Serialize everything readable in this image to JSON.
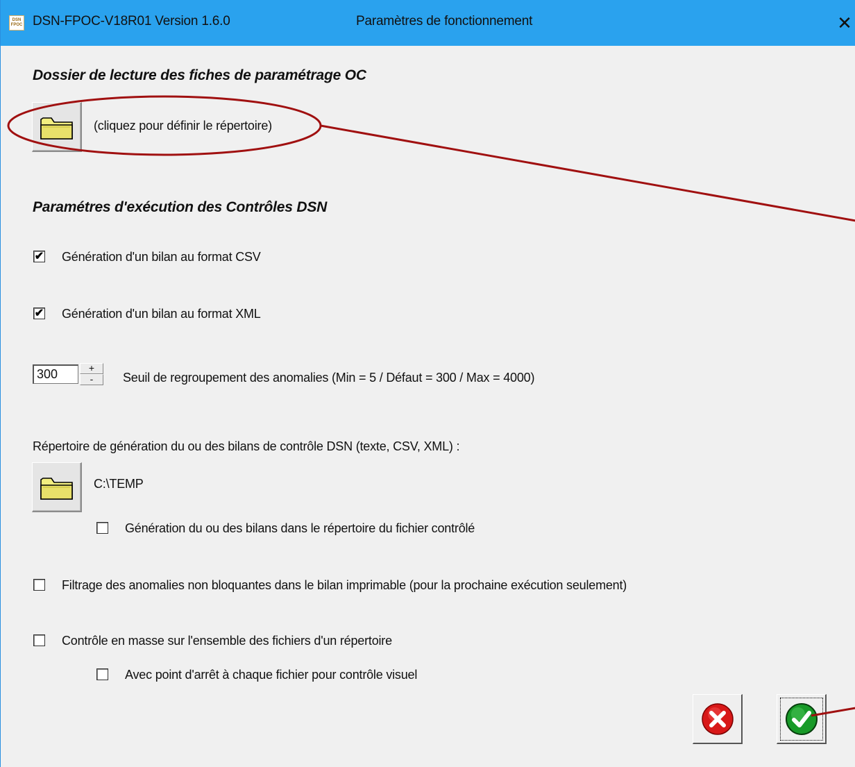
{
  "titlebar": {
    "app_title": "DSN-FPOC-V18R01 Version 1.6.0",
    "window_title": "Paramètres de fonctionnement",
    "close_label": "✕",
    "icon_text": "DSN FPOC"
  },
  "section_oc": {
    "title": "Dossier de lecture des fiches de paramétrage OC",
    "folder_hint": "(cliquez pour définir le répertoire)"
  },
  "section_exec": {
    "title": "Paramétres d'exécution des Contrôles DSN",
    "csv": {
      "label": "Génération d'un bilan au format CSV",
      "checked": true
    },
    "xml": {
      "label": "Génération d'un bilan au format XML",
      "checked": true
    },
    "threshold": {
      "value": "300",
      "label": "Seuil de regroupement des anomalies (Min = 5 / Défaut = 300 / Max = 4000)",
      "up_glyph": "+",
      "down_glyph": "-"
    },
    "output_dir_label": "Répertoire de génération du ou des bilans de contrôle DSN (texte, CSV, XML) :",
    "output_dir_value": "C:\\TEMP",
    "same_dir": {
      "label": "Génération du ou des bilans dans le répertoire du fichier contrôlé",
      "checked": false
    },
    "filter": {
      "label": "Filtrage des anomalies non bloquantes dans le bilan imprimable (pour la prochaine exécution seulement)",
      "checked": false
    },
    "mass": {
      "label": "Contrôle en masse sur l'ensemble des fichiers d'un répertoire",
      "checked": false
    },
    "stop_each": {
      "label": "Avec point d'arrêt à chaque fichier pour contrôle visuel",
      "checked": false
    }
  },
  "colors": {
    "titlebar": "#2aa2ee",
    "annotation": "#a01010",
    "cancel_red": "#d81818",
    "ok_green": "#189a28"
  },
  "icons": {
    "folder": "folder-icon",
    "cancel": "cancel-icon",
    "ok": "check-icon"
  }
}
